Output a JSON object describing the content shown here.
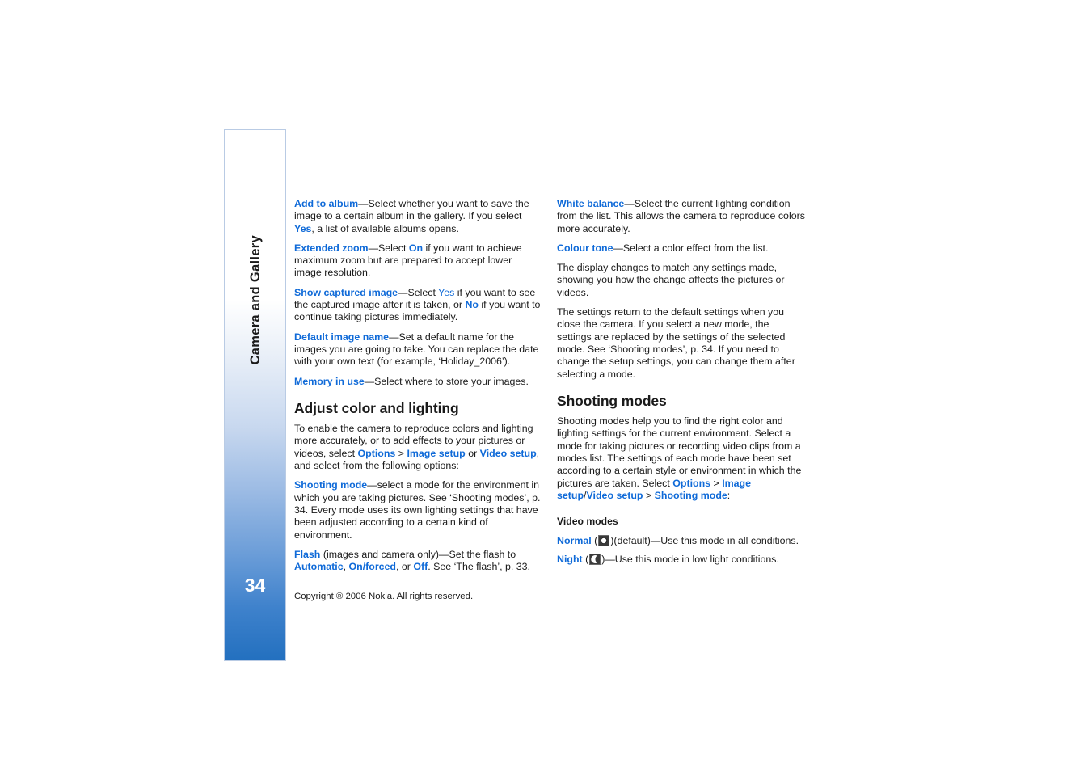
{
  "document": {
    "title": "Camera and Gallery",
    "page_number": "34",
    "copyright": "Copyright ® 2006 Nokia. All rights reserved.",
    "accent_color": "#0f6ad8",
    "tab_bottom_color": "#2370bf",
    "text_color": "#1a1a1a"
  },
  "left_column": {
    "paragraphs": [
      {
        "id": "add-to-album",
        "parts": [
          {
            "t": "kw",
            "v": "Add to album"
          },
          {
            "t": "plain",
            "v": "—Select whether you want to save the image to a certain album in the gallery. If you select "
          },
          {
            "t": "kw",
            "v": "Yes"
          },
          {
            "t": "plain",
            "v": ", a list of available albums opens."
          }
        ]
      },
      {
        "id": "extended-zoom",
        "parts": [
          {
            "t": "kw",
            "v": "Extended zoom"
          },
          {
            "t": "plain",
            "v": "—Select "
          },
          {
            "t": "kw",
            "v": "On"
          },
          {
            "t": "plain",
            "v": " if you want to achieve maximum zoom but are prepared to accept lower image resolution."
          }
        ]
      },
      {
        "id": "show-captured-image",
        "parts": [
          {
            "t": "kw",
            "v": "Show captured image"
          },
          {
            "t": "plain",
            "v": "—Select "
          },
          {
            "t": "kw-reg",
            "v": "Yes"
          },
          {
            "t": "plain",
            "v": " if you want to see the captured image after it is taken, or "
          },
          {
            "t": "kw",
            "v": "No"
          },
          {
            "t": "plain",
            "v": " if you want to continue taking pictures immediately."
          }
        ]
      },
      {
        "id": "default-image-name",
        "parts": [
          {
            "t": "kw",
            "v": "Default image name"
          },
          {
            "t": "plain",
            "v": "—Set a default name for the images you are going to take. You can replace the date with your own text (for example, ‘Holiday_2006’)."
          }
        ]
      },
      {
        "id": "memory-in-use",
        "parts": [
          {
            "t": "kw",
            "v": "Memory in use"
          },
          {
            "t": "plain",
            "v": "—Select where to store your images."
          }
        ]
      }
    ],
    "heading": "Adjust color and lighting",
    "paragraphs_after": [
      {
        "id": "enable-camera",
        "parts": [
          {
            "t": "plain",
            "v": "To enable the camera to reproduce colors and lighting more accurately, or to add effects to your pictures or videos, select "
          },
          {
            "t": "kw",
            "v": "Options"
          },
          {
            "t": "plain",
            "v": " > "
          },
          {
            "t": "kw",
            "v": "Image setup"
          },
          {
            "t": "plain",
            "v": " or "
          },
          {
            "t": "kw",
            "v": "Video setup"
          },
          {
            "t": "plain",
            "v": ", and select from the following options:"
          }
        ]
      },
      {
        "id": "shooting-mode",
        "parts": [
          {
            "t": "kw",
            "v": "Shooting mode"
          },
          {
            "t": "plain",
            "v": "—select a mode for the environment in which you are taking pictures. See ‘Shooting modes’, p. 34. Every mode uses its own lighting settings that have been adjusted according to a certain kind of environment."
          }
        ]
      },
      {
        "id": "flash",
        "parts": [
          {
            "t": "kw",
            "v": "Flash"
          },
          {
            "t": "plain",
            "v": " (images and camera only)—Set the flash to "
          },
          {
            "t": "kw",
            "v": "Automatic"
          },
          {
            "t": "plain",
            "v": ", "
          },
          {
            "t": "kw",
            "v": "On/forced"
          },
          {
            "t": "plain",
            "v": ", or "
          },
          {
            "t": "kw",
            "v": "Off"
          },
          {
            "t": "plain",
            "v": ". See ‘The flash’, p. 33."
          }
        ]
      }
    ]
  },
  "right_column": {
    "paragraphs": [
      {
        "id": "white-balance",
        "parts": [
          {
            "t": "kw",
            "v": "White balance"
          },
          {
            "t": "plain",
            "v": "—Select the current lighting condition from the list. This allows the camera to reproduce colors more accurately."
          }
        ]
      },
      {
        "id": "colour-tone",
        "parts": [
          {
            "t": "kw",
            "v": "Colour tone"
          },
          {
            "t": "plain",
            "v": "—Select a color effect from the list."
          }
        ]
      },
      {
        "id": "display-changes",
        "parts": [
          {
            "t": "plain",
            "v": "The display changes to match any settings made, showing you how the change affects the pictures or videos."
          }
        ]
      },
      {
        "id": "settings-return",
        "parts": [
          {
            "t": "plain",
            "v": "The settings return to the default settings when you close the camera. If you select a new mode, the settings are replaced by the settings of the selected mode. See ‘Shooting modes’, p. 34. If you need to change the setup settings, you can change them after selecting a mode."
          }
        ]
      }
    ],
    "heading": "Shooting modes",
    "intro": {
      "id": "shooting-modes-intro",
      "parts": [
        {
          "t": "plain",
          "v": "Shooting modes help you to find the right color and lighting settings for the current environment. Select a mode for taking pictures or recording video clips from a modes list. The settings of each mode have been set according to a certain style or environment in which the pictures are taken. Select "
        },
        {
          "t": "kw",
          "v": "Options"
        },
        {
          "t": "plain",
          "v": " > "
        },
        {
          "t": "kw",
          "v": "Image setup"
        },
        {
          "t": "plain",
          "v": "/"
        },
        {
          "t": "kw",
          "v": "Video setup"
        },
        {
          "t": "plain",
          "v": " > "
        },
        {
          "t": "kw",
          "v": "Shooting mode"
        },
        {
          "t": "plain",
          "v": ":"
        }
      ]
    },
    "sub_heading": "Video modes",
    "video_modes": [
      {
        "id": "normal",
        "name": "Normal",
        "icon": "normal-mode-icon",
        "open_paren": " (",
        "close_paren": ")",
        "description": "(default)—Use this mode in all conditions."
      },
      {
        "id": "night",
        "name": "Night",
        "icon": "night-mode-icon",
        "open_paren": " (",
        "close_paren": ")",
        "description": "—Use this mode in low light conditions."
      }
    ]
  }
}
